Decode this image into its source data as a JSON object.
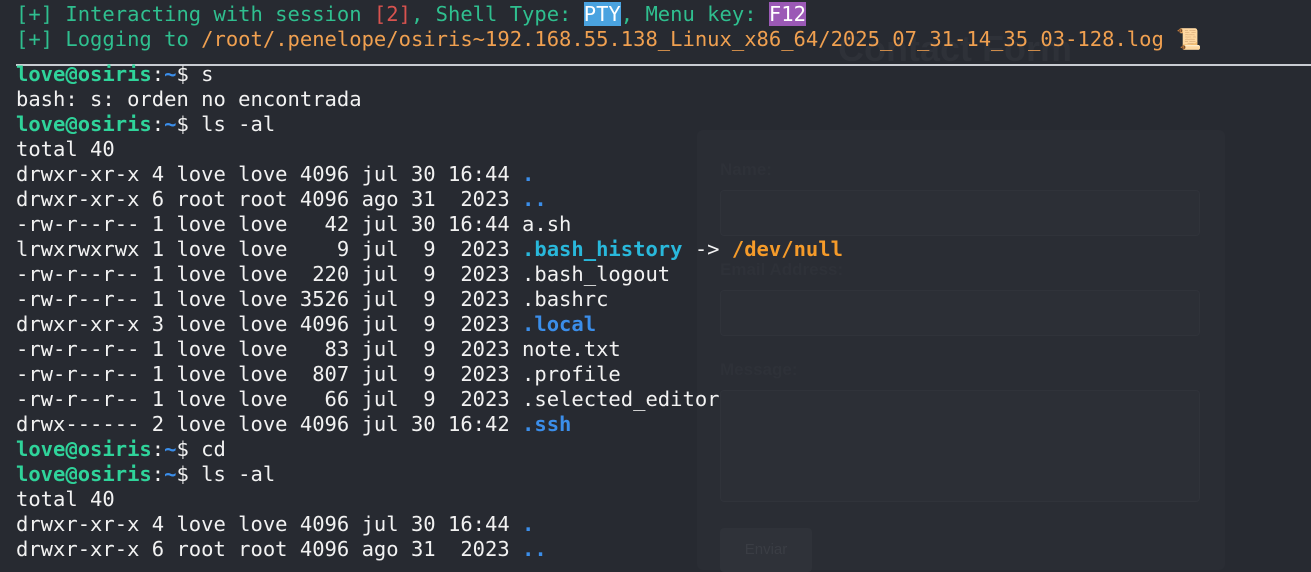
{
  "header": {
    "line1": {
      "prefix": "[+] Interacting with session ",
      "session_id": "[2]",
      "mid": ", Shell Type: ",
      "shell_type": "PTY",
      "mid2": ", Menu key: ",
      "menu_key": "F12"
    },
    "line2": {
      "prefix": "[+] Logging to ",
      "log_path": "/root/.penelope/osiris~192.168.55.138_Linux_x86_64/2025_07_31-14_35_03-128.log",
      "icon": "scroll-icon"
    }
  },
  "background_page": {
    "title": "Contact Form",
    "labels": {
      "name": "Name:",
      "email": "Email Address:",
      "message": "Message:"
    },
    "button": "Enviar"
  },
  "terminal": {
    "prompt_user": "love@osiris",
    "prompt_path": "~",
    "prompt_sep": ":",
    "prompt_end": "$ ",
    "cmd1": "s",
    "error1": "bash: s: orden no encontrada",
    "cmd2": "ls -al",
    "total1": "total 40",
    "listing": [
      {
        "perm": "drwxr-xr-x 4 love love 4096 jul 30 16:44 ",
        "name": ".",
        "kind": "dir"
      },
      {
        "perm": "drwxr-xr-x 6 root root 4096 ago 31  2023 ",
        "name": "..",
        "kind": "dir"
      },
      {
        "perm": "-rw-r--r-- 1 love love   42 jul 30 16:44 ",
        "name": "a.sh",
        "kind": "file"
      },
      {
        "perm": "lrwxrwxrwx 1 love love    9 jul  9  2023 ",
        "name": ".bash_history",
        "kind": "link",
        "arrow": " -> ",
        "target": "/dev/null"
      },
      {
        "perm": "-rw-r--r-- 1 love love  220 jul  9  2023 ",
        "name": ".bash_logout",
        "kind": "file"
      },
      {
        "perm": "-rw-r--r-- 1 love love 3526 jul  9  2023 ",
        "name": ".bashrc",
        "kind": "file"
      },
      {
        "perm": "drwxr-xr-x 3 love love 4096 jul  9  2023 ",
        "name": ".local",
        "kind": "dir"
      },
      {
        "perm": "-rw-r--r-- 1 love love   83 jul  9  2023 ",
        "name": "note.txt",
        "kind": "file"
      },
      {
        "perm": "-rw-r--r-- 1 love love  807 jul  9  2023 ",
        "name": ".profile",
        "kind": "file"
      },
      {
        "perm": "-rw-r--r-- 1 love love   66 jul  9  2023 ",
        "name": ".selected_editor",
        "kind": "file"
      },
      {
        "perm": "drwx------ 2 love love 4096 jul 30 16:42 ",
        "name": ".ssh",
        "kind": "dir"
      }
    ],
    "cmd3": "cd",
    "cmd4": "ls -al",
    "total2": "total 40",
    "listing2": [
      {
        "perm": "drwxr-xr-x 4 love love 4096 jul 30 16:44 ",
        "name": ".",
        "kind": "dir"
      },
      {
        "perm": "drwxr-xr-x 6 root root 4096 ago 31  2023 ",
        "name": "..",
        "kind": "dir"
      }
    ]
  }
}
